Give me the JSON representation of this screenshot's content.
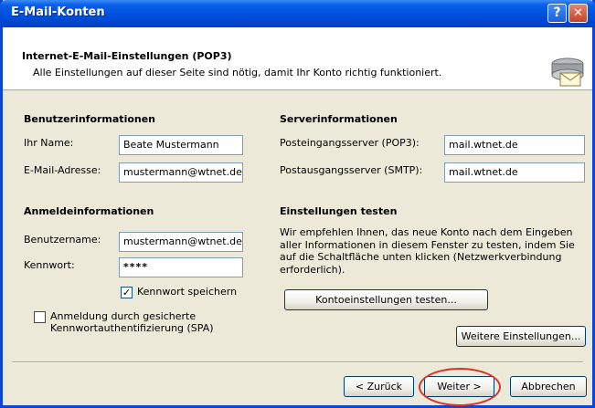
{
  "window": {
    "title": "E-Mail-Konten",
    "help_glyph": "?",
    "close_glyph": "✕"
  },
  "header": {
    "title": "Internet-E-Mail-Einstellungen (POP3)",
    "subtitle": "Alle Einstellungen auf dieser Seite sind nötig, damit Ihr Konto richtig funktioniert.",
    "icon": "mail-server-icon"
  },
  "user_info": {
    "heading": "Benutzerinformationen",
    "name_label": "Ihr Name:",
    "name_value": "Beate Mustermann",
    "email_label": "E-Mail-Adresse:",
    "email_value": "mustermann@wtnet.de"
  },
  "server_info": {
    "heading": "Serverinformationen",
    "incoming_label": "Posteingangsserver (POP3):",
    "incoming_value": "mail.wtnet.de",
    "outgoing_label": "Postausgangsserver (SMTP):",
    "outgoing_value": "mail.wtnet.de"
  },
  "login_info": {
    "heading": "Anmeldeinformationen",
    "username_label": "Benutzername:",
    "username_value": "mustermann@wtnet.de",
    "password_label": "Kennwort:",
    "password_value": "****",
    "save_password_label": "Kennwort speichern",
    "save_password_checked": true,
    "spa_label_line1": "Anmeldung durch gesicherte",
    "spa_label_line2": "Kennwortauthentifizierung (SPA)",
    "spa_checked": false
  },
  "test_settings": {
    "heading": "Einstellungen testen",
    "description": "Wir empfehlen Ihnen, das neue Konto nach dem Eingeben aller Informationen in diesem Fenster zu testen, indem Sie auf die Schaltfläche unten klicken (Netzwerkverbindung erforderlich).",
    "test_button": "Kontoeinstellungen testen...",
    "more_settings_button": "Weitere Einstellungen..."
  },
  "footer": {
    "back_button": "< Zurück",
    "next_button": "Weiter >",
    "cancel_button": "Abbrechen",
    "highlight_color": "#d9342b"
  }
}
